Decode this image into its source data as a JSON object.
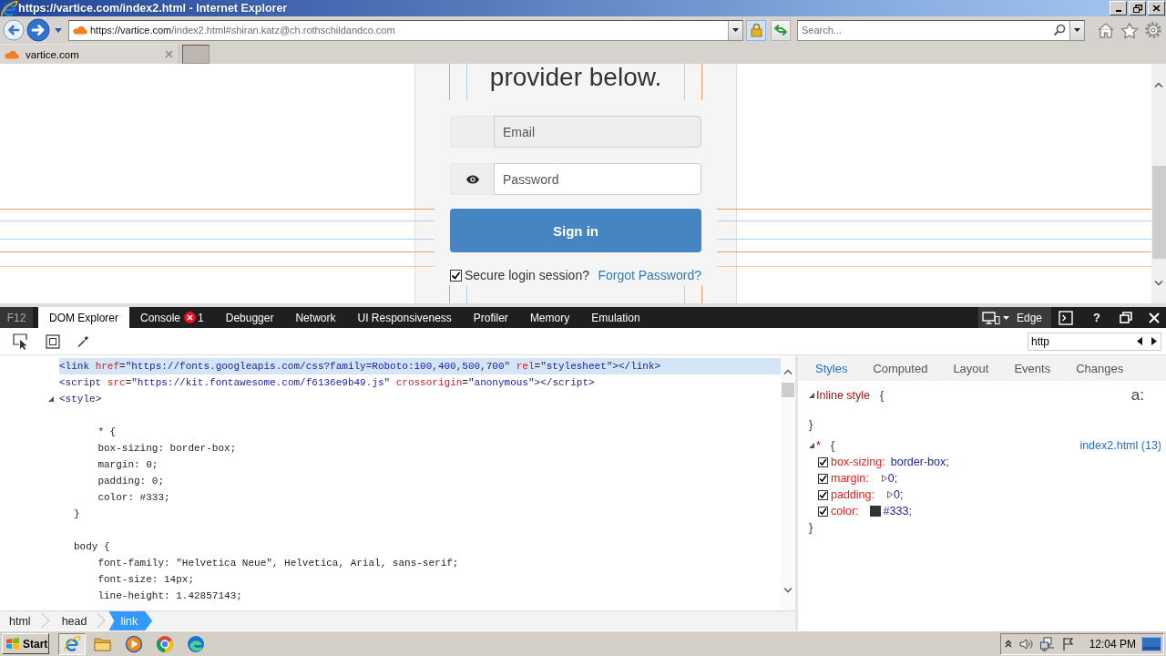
{
  "window": {
    "title": "https://vartice.com/index2.html - Internet Explorer"
  },
  "navigation": {
    "url_host": "https://vartice.com",
    "url_path": "/index2.html#shiran.katz@ch.rothschildandco.com",
    "search": {
      "placeholder": "Search..."
    }
  },
  "tabs": [
    {
      "label": "vartice.com",
      "selected": true
    }
  ],
  "page": {
    "heading": "provider below.",
    "fields": [
      {
        "kind": "email",
        "placeholder": "Email",
        "readonly": true
      },
      {
        "kind": "password",
        "placeholder": "Password",
        "readonly": false
      }
    ],
    "submit": "Sign in",
    "remember": {
      "label": "Secure login session?",
      "checked": true
    },
    "forgot_link": "Forgot Password?"
  },
  "devtools": {
    "f12_label": "F12",
    "tabs": [
      {
        "label": "DOM Explorer",
        "selected": true
      },
      {
        "label": "Console",
        "selected": false,
        "error_count": "1"
      },
      {
        "label": "Debugger",
        "selected": false
      },
      {
        "label": "Network",
        "selected": false
      },
      {
        "label": "UI Responsiveness",
        "selected": false
      },
      {
        "label": "Profiler",
        "selected": false
      },
      {
        "label": "Memory",
        "selected": false
      },
      {
        "label": "Emulation",
        "selected": false
      }
    ],
    "document_mode": "Edge",
    "help": "?",
    "find": {
      "value": "http"
    },
    "dom_tree": [
      {
        "markup": "<link href=\"https://fonts.googleapis.com/css?family=Roboto:100,400,500,700\" rel=\"stylesheet\"></link>",
        "selected": true
      },
      {
        "markup": "<script src=\"https://kit.fontawesome.com/f6136e9b49.js\" crossorigin=\"anonymous\"></script>",
        "selected": false
      },
      {
        "markup": "<style>",
        "selected": false,
        "expanded": true,
        "children": [
          {
            "kind": "text",
            "lines": [
              "    * {",
              "    box-sizing: border-box;",
              "    margin: 0;",
              "    padding: 0;",
              "    color: #333;",
              "}"
            ]
          },
          {
            "kind": "text",
            "lines": [
              "body {",
              "    font-family: \"Helvetica Neue\", Helvetica, Arial, sans-serif;",
              "    font-size: 14px;",
              "    line-height: 1.42857143;"
            ]
          }
        ]
      }
    ],
    "breadcrumb": [
      {
        "label": "html",
        "selected": false
      },
      {
        "label": "head",
        "selected": false
      },
      {
        "label": "link",
        "selected": true
      }
    ],
    "style_tabs": [
      {
        "label": "Styles",
        "selected": true
      },
      {
        "label": "Computed",
        "selected": false
      },
      {
        "label": "Layout",
        "selected": false
      },
      {
        "label": "Events",
        "selected": false
      },
      {
        "label": "Changes",
        "selected": false
      }
    ],
    "state_toggle": "a:",
    "rules": [
      {
        "selector": "Inline style",
        "open": "{",
        "close": "}",
        "expanded": true
      },
      {
        "selector": "*",
        "open": "{",
        "close": "}",
        "expanded": true,
        "source": "index2.html (13)",
        "properties": [
          {
            "kind": "plain",
            "name": "box-sizing:",
            "value": "border-box;",
            "checked": true
          },
          {
            "kind": "shorthand",
            "name": "margin:",
            "value": "0;",
            "checked": true
          },
          {
            "kind": "shorthand",
            "name": "padding:",
            "value": "0;",
            "checked": true
          },
          {
            "kind": "color",
            "name": "color:",
            "value": "#333;",
            "checked": true
          }
        ]
      }
    ]
  },
  "taskbar": {
    "start": "Start",
    "apps": [
      {
        "kind": "internet_explorer",
        "selected": true
      },
      {
        "kind": "folder",
        "selected": false
      },
      {
        "kind": "media_player",
        "selected": false
      },
      {
        "kind": "chrome",
        "selected": false
      },
      {
        "kind": "edge",
        "selected": false
      }
    ],
    "clock": "12:04 PM"
  }
}
